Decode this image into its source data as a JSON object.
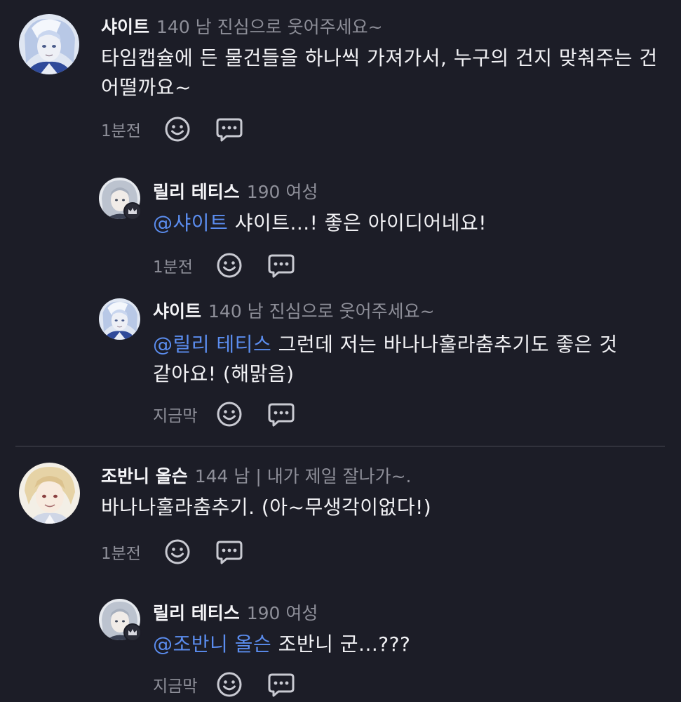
{
  "comments": [
    {
      "name": "샤이트",
      "meta": "140 남 진심으로 웃어주세요~",
      "mention": "",
      "text": "타임캡슐에 든 물건들을 하나씩 가져가서, 누구의 건지 맞춰주는 건 어떨까요~",
      "time": "1분전"
    },
    {
      "name": "릴리 테티스",
      "meta": "190 여성",
      "mention": "@샤이트",
      "text": "샤이트...! 좋은 아이디어네요!",
      "time": "1분전"
    },
    {
      "name": "샤이트",
      "meta": "140 남 진심으로 웃어주세요~",
      "mention": "@릴리 테티스",
      "text": "그런데 저는 바나나훌라춤추기도 좋은 것 같아요! (해맑음)",
      "time": "지금막"
    },
    {
      "name": "조반니 올슨",
      "meta": "144 남 | 내가 제일 잘나가~.",
      "mention": "",
      "text": "바나나훌라춤추기. (아~무생각이없다!)",
      "time": "1분전"
    },
    {
      "name": "릴리 테티스",
      "meta": "190 여성",
      "mention": "@조반니 올슨",
      "text": "조반니 군...???",
      "time": "지금막"
    }
  ],
  "colors": {
    "background": "#1c1d27",
    "mention": "#5b8def",
    "meta": "#8e8f99",
    "divider": "#4a4b55"
  },
  "icons": {
    "react": "smiley-icon",
    "reply": "speech-bubble-icon",
    "badge": "crown-icon"
  }
}
